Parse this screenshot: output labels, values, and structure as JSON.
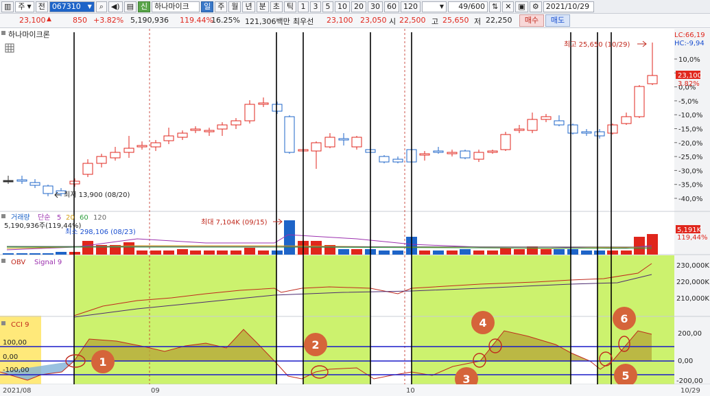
{
  "toolbar": {
    "period_label": "주",
    "prev_label": "전",
    "stock_code": "067310",
    "stock_badge": "신",
    "stock_name": "하나마이크",
    "tabs": [
      "일",
      "주",
      "월",
      "년",
      "분",
      "초",
      "틱"
    ],
    "interval_buttons": [
      "1",
      "3",
      "5",
      "10",
      "20",
      "30",
      "60",
      "120"
    ],
    "counter": "49/600",
    "date": "2021/10/29"
  },
  "price_bar": {
    "price": "23,100",
    "change": "850",
    "change_pct": "+3.82%",
    "volume": "5,190,936",
    "volume_ratio": "119.44%",
    "turnover": "16.25%",
    "amount": "121,306백만",
    "bid_label": "최우선",
    "bid_price": "23,100",
    "ask_price": "23,050",
    "open_label": "시",
    "open": "22,500",
    "high_label": "고",
    "high": "25,650",
    "low_label": "저",
    "low": "22,250",
    "buy_label": "매수",
    "sell_label": "매도"
  },
  "price_panel": {
    "title": "하나마이크론",
    "lc_label": "LC:66,19",
    "hc_label": "HC:-9,94",
    "high_annotation": "최고 25,650 (10/29)",
    "low_annotation": "최저 13,900 (08/20)",
    "current_price_tag": "23,100",
    "current_pct_tag": "3.82%",
    "y_ticks": [
      "10,0%",
      "5,0%",
      "0,0%",
      "-5,0%",
      "-10,0%",
      "-15,0%",
      "-20,0%",
      "-25,0%",
      "-30,0%",
      "-35,0%",
      "-40,0%"
    ]
  },
  "volume_panel": {
    "legend": [
      "거래량",
      "단순",
      "5",
      "20",
      "60",
      "120"
    ],
    "legend_colors": [
      "#1e64c8",
      "#9b2fae",
      "#9b2fae",
      "#d4a017",
      "#2e9e3e",
      "#666666"
    ],
    "volume_text": "5,190,936주(119,44%)",
    "max_annotation": "최대 7,104K (09/15)",
    "min_annotation": "최소 298,106 (08/23)",
    "vol_tag": "5,191K",
    "vol_pct_tag": "119,44%"
  },
  "obv_panel": {
    "legend": [
      "OBV",
      "Signal 9"
    ],
    "legend_colors": [
      "#c0281c",
      "#9b2fae"
    ],
    "y_ticks": [
      "230,000K",
      "220,000K",
      "210,000K"
    ]
  },
  "cci_panel": {
    "legend": "CCI 9",
    "left_levels": [
      "100,00",
      "0,00",
      "-100,00"
    ],
    "y_ticks": [
      "200,00",
      "0,00",
      "-200,00"
    ]
  },
  "x_axis": {
    "labels": [
      "2021/08",
      "09",
      "10",
      "10/29"
    ]
  },
  "markers": [
    "1",
    "2",
    "3",
    "4",
    "5",
    "6"
  ],
  "colors": {
    "up": "#e0261c",
    "down": "#1e64c8",
    "highlight": "#ccf26e",
    "marker": "#d5643a"
  }
}
